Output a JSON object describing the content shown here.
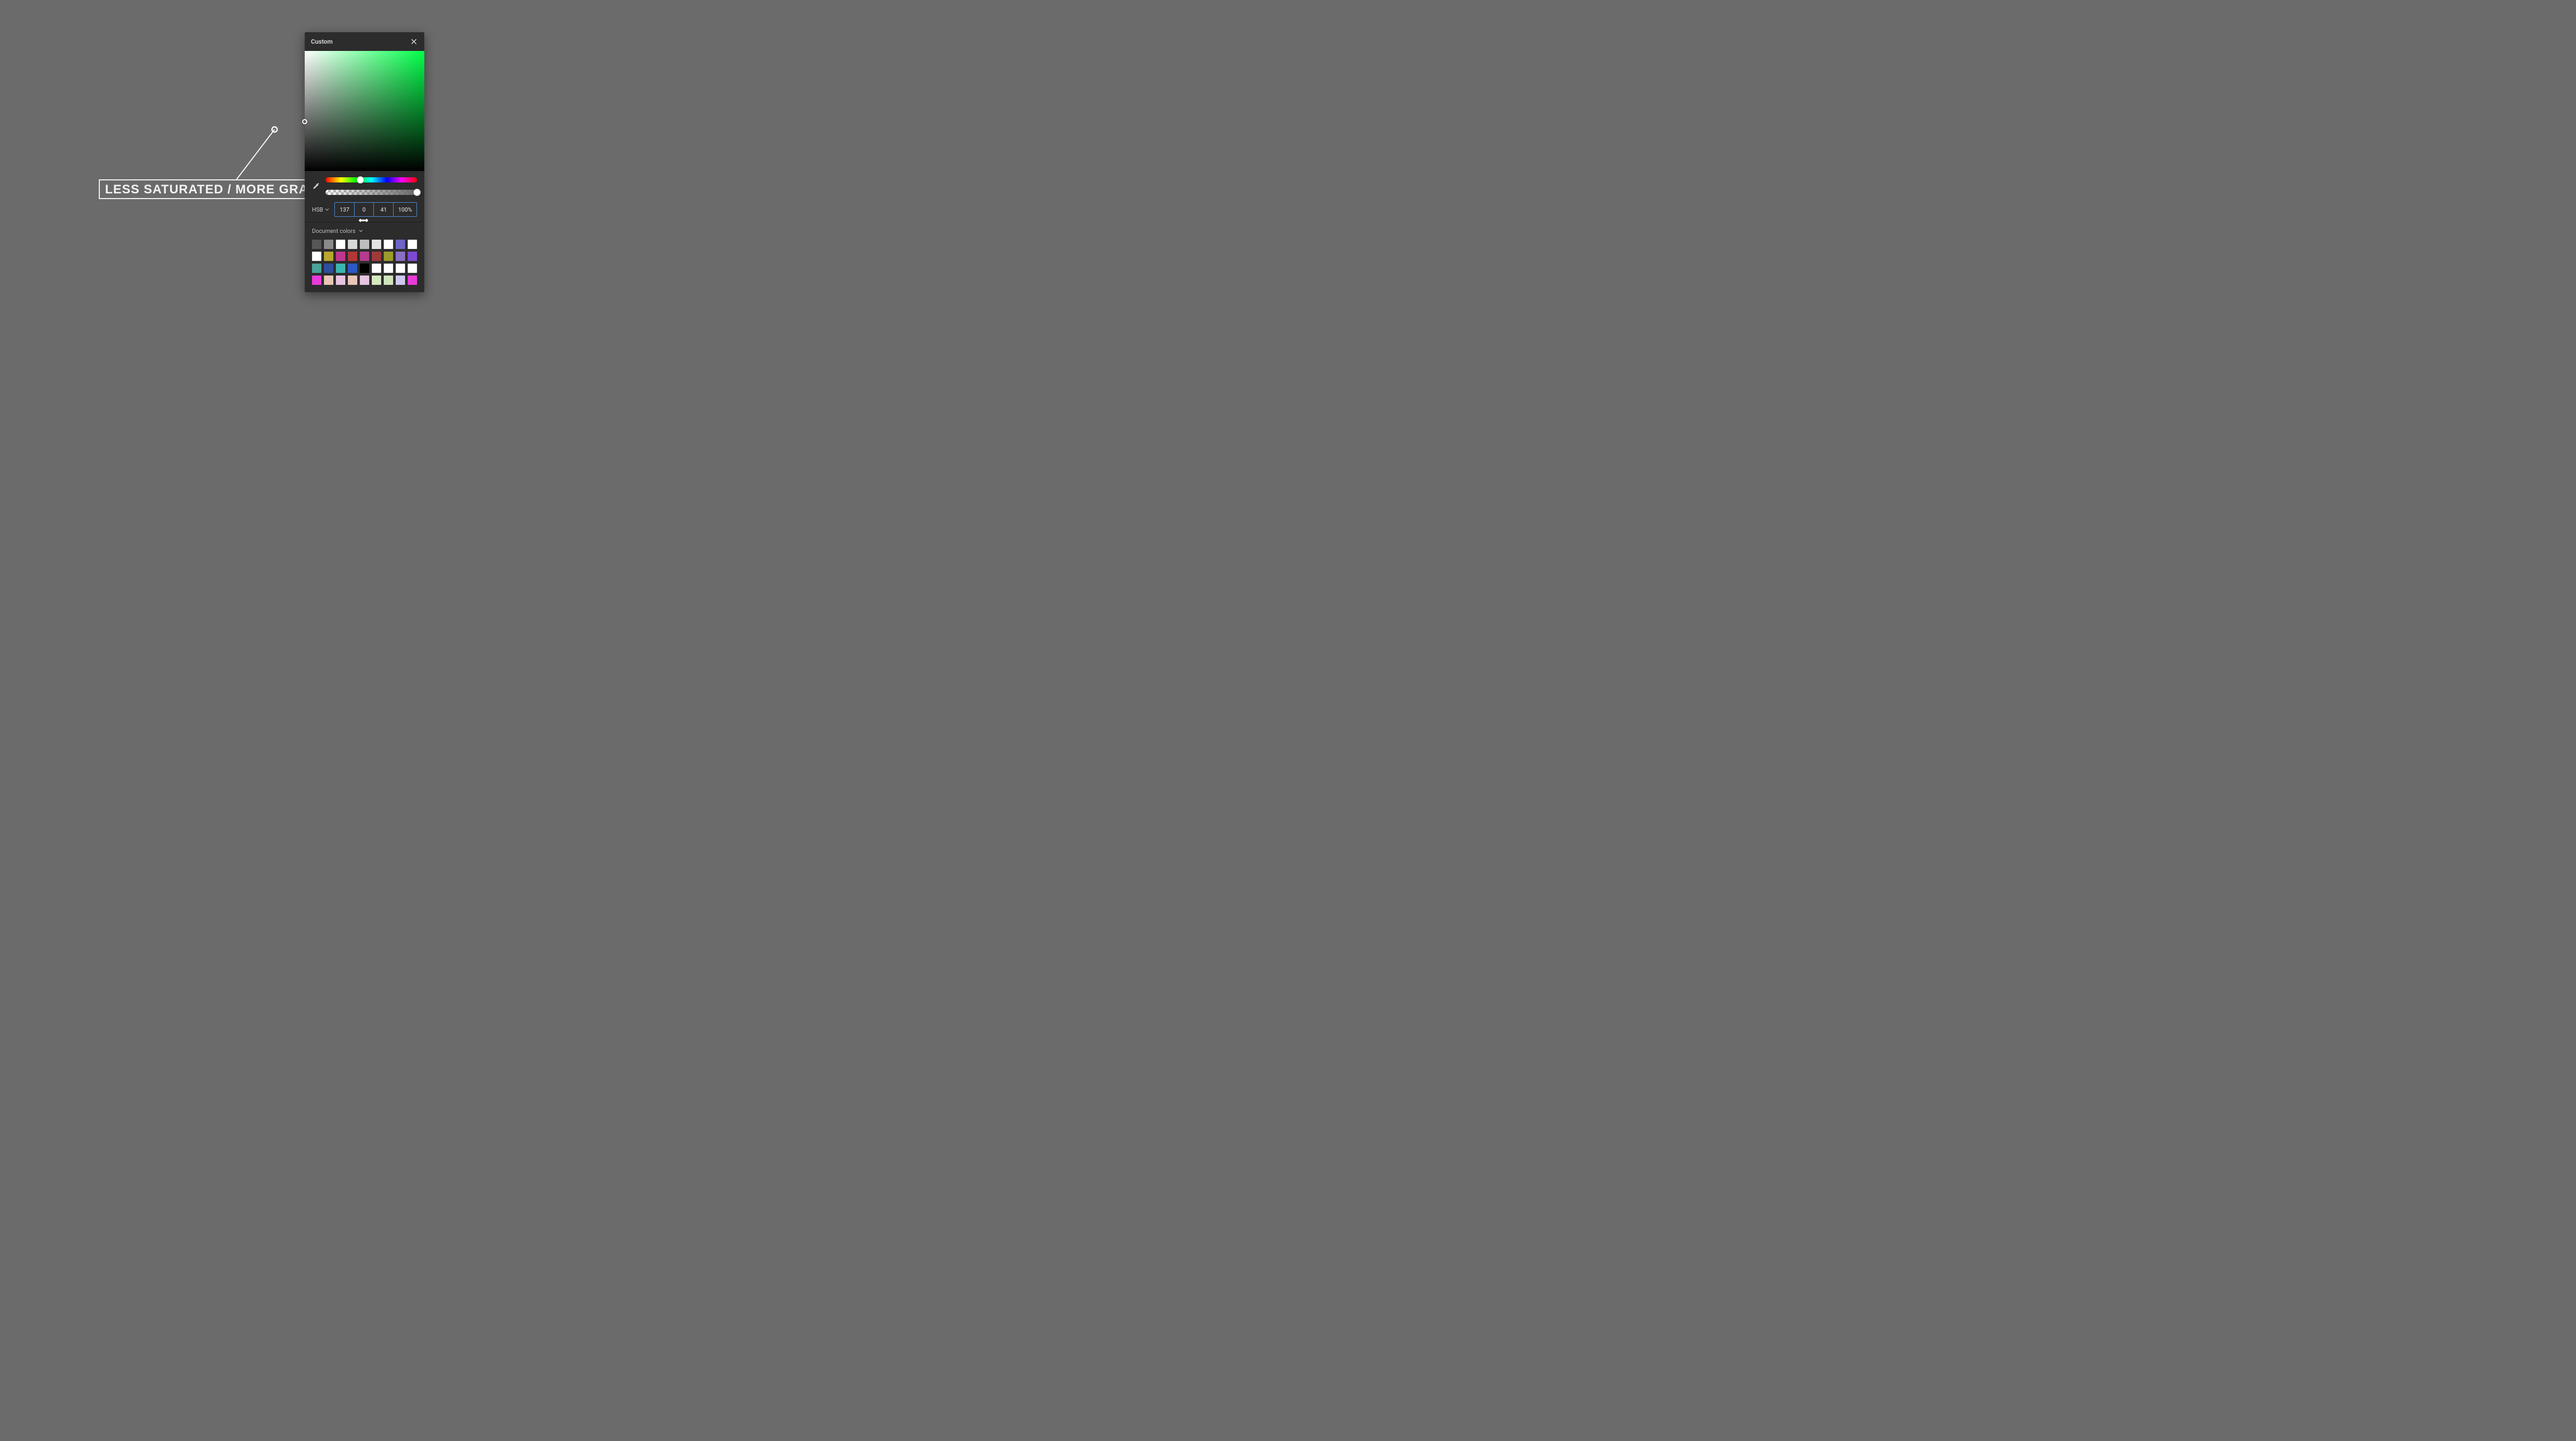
{
  "annotation": {
    "label": "LESS SATURATED / MORE GRAY"
  },
  "panel": {
    "title": "Custom",
    "mode_label": "HSB",
    "hue_value": "137",
    "saturation_value": "0",
    "brightness_value": "41",
    "alpha_value": "100%",
    "doc_colors_label": "Document colors",
    "hue_position_pct": 38,
    "alpha_position_pct": 100,
    "saturation_pct": 0,
    "brightness_pct": 41,
    "swatches": [
      "#575757",
      "#8a8a8a",
      "#ffffff",
      "#d8d8d8",
      "#bdbdbd",
      "#e4e4e4",
      "#ffffff",
      "#6d64c6",
      "#ffffff",
      "#ffffff",
      "#b9a72e",
      "#c1368d",
      "#b23838",
      "#b53c8d",
      "#a03a3a",
      "#9b9a2a",
      "#8b6fc2",
      "#7d4ad1",
      "#4aa29a",
      "#2f4e9b",
      "#3cb4b0",
      "#2c58c8",
      "#000000",
      "#ffffff",
      "#ffffff",
      "#ffffff",
      "#ffffff",
      "#e83bd8",
      "#e9c5b7",
      "#e7c3e2",
      "#e9c5b7",
      "#e7c3e2",
      "#d4e9bd",
      "#cfe3bf",
      "#cfc8f0",
      "#e83bd8"
    ]
  }
}
